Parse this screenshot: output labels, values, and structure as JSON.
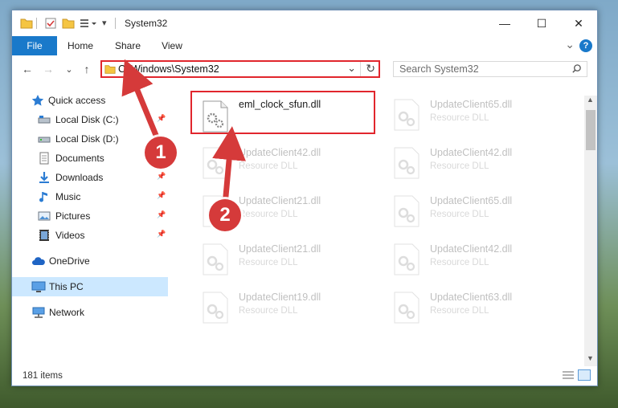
{
  "window": {
    "title": "System32",
    "controls": {
      "minimize": "—",
      "maximize": "☐",
      "close": "✕"
    }
  },
  "ribbon": {
    "tabs": [
      "File",
      "Home",
      "Share",
      "View"
    ],
    "expand_chevron": "⌄",
    "help": "?"
  },
  "address_bar": {
    "path": "C:\\Windows\\System32",
    "dropdown": "⌄",
    "refresh": "↻"
  },
  "search": {
    "placeholder": "Search System32",
    "icon": "search-icon"
  },
  "navigation": {
    "back": "←",
    "forward": "→",
    "recent": "⌄",
    "up": "↑"
  },
  "nav_pane": {
    "items": [
      {
        "label": "Quick access",
        "icon": "star-icon",
        "pinned": false
      },
      {
        "label": "Local Disk (C:)",
        "icon": "drive-icon",
        "pinned": true
      },
      {
        "label": "Local Disk (D:)",
        "icon": "drive-icon",
        "pinned": false
      },
      {
        "label": "Documents",
        "icon": "document-icon",
        "pinned": false
      },
      {
        "label": "Downloads",
        "icon": "download-icon",
        "pinned": true
      },
      {
        "label": "Music",
        "icon": "music-icon",
        "pinned": true
      },
      {
        "label": "Pictures",
        "icon": "picture-icon",
        "pinned": true
      },
      {
        "label": "Videos",
        "icon": "video-icon",
        "pinned": true
      },
      {
        "label": "OneDrive",
        "icon": "cloud-icon",
        "pinned": false
      },
      {
        "label": "This PC",
        "icon": "computer-icon",
        "pinned": false,
        "selected": true
      },
      {
        "label": "Network",
        "icon": "network-icon",
        "pinned": false
      }
    ]
  },
  "files": [
    {
      "name": "eml_clock_sfun.dll",
      "type": "",
      "highlighted": true,
      "faded": false
    },
    {
      "name": "UpdateClient65.dll",
      "type": "Resource DLL",
      "highlighted": false,
      "faded": true
    },
    {
      "name": "UpdateClient42.dll",
      "type": "Resource DLL",
      "highlighted": false,
      "faded": true
    },
    {
      "name": "UpdateClient42.dll",
      "type": "Resource DLL",
      "highlighted": false,
      "faded": true
    },
    {
      "name": "UpdateClient21.dll",
      "type": "Resource DLL",
      "highlighted": false,
      "faded": true
    },
    {
      "name": "UpdateClient65.dll",
      "type": "Resource DLL",
      "highlighted": false,
      "faded": true
    },
    {
      "name": "UpdateClient21.dll",
      "type": "Resource DLL",
      "highlighted": false,
      "faded": true
    },
    {
      "name": "UpdateClient42.dll",
      "type": "Resource DLL",
      "highlighted": false,
      "faded": true
    },
    {
      "name": "UpdateClient19.dll",
      "type": "Resource DLL",
      "highlighted": false,
      "faded": true
    },
    {
      "name": "UpdateClient63.dll",
      "type": "Resource DLL",
      "highlighted": false,
      "faded": true
    }
  ],
  "status_bar": {
    "item_count": "181 items"
  },
  "annotations": [
    {
      "label": "1"
    },
    {
      "label": "2"
    }
  ],
  "colors": {
    "accent": "#1979ca",
    "highlight_border": "#e1262d",
    "badge": "#d53a3a",
    "selection": "#cce8ff"
  }
}
